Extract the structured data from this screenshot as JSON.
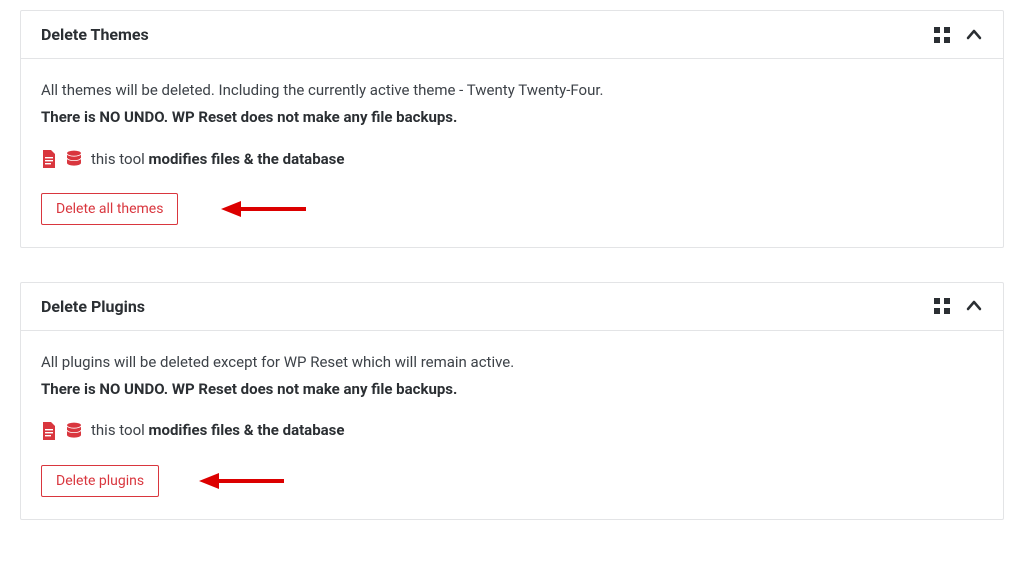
{
  "cards": [
    {
      "title": "Delete Themes",
      "description": "All themes will be deleted. Including the currently active theme - Twenty Twenty-Four.",
      "warning": "There is NO UNDO. WP Reset does not make any file backups.",
      "mod_prefix": "this tool ",
      "mod_bold": "modifies files & the database",
      "button_label": "Delete all themes"
    },
    {
      "title": "Delete Plugins",
      "description": "All plugins will be deleted except for WP Reset which will remain active.",
      "warning": "There is NO UNDO. WP Reset does not make any file backups.",
      "mod_prefix": "this tool ",
      "mod_bold": "modifies files & the database",
      "button_label": "Delete plugins"
    }
  ]
}
